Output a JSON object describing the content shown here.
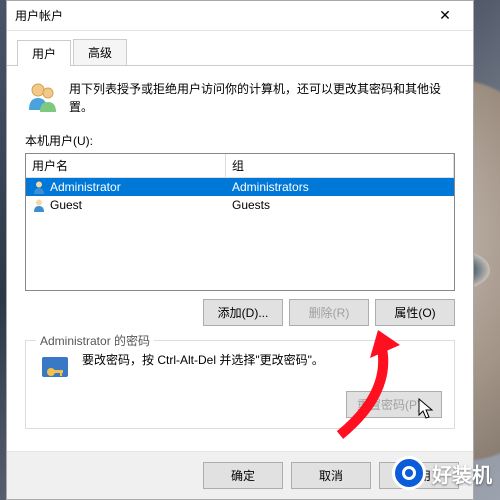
{
  "window": {
    "title": "用户帐户",
    "close_symbol": "✕"
  },
  "tabs": {
    "user": "用户",
    "advanced": "高级"
  },
  "intro": "用下列表授予或拒绝用户访问你的计算机，还可以更改其密码和其他设置。",
  "users_label": "本机用户(U):",
  "table": {
    "col_user": "用户名",
    "col_group": "组",
    "rows": [
      {
        "name": "Administrator",
        "group": "Administrators",
        "selected": true
      },
      {
        "name": "Guest",
        "group": "Guests",
        "selected": false
      }
    ]
  },
  "buttons": {
    "add": "添加(D)...",
    "delete": "删除(R)",
    "properties": "属性(O)"
  },
  "password": {
    "legend": "Administrator 的密码",
    "text": "要改密码，按 Ctrl-Alt-Del 并选择\"更改密码\"。",
    "reset": "重置密码(P)..."
  },
  "footer": {
    "ok": "确定",
    "cancel": "取消",
    "apply": "应用"
  },
  "watermark": "好装机"
}
